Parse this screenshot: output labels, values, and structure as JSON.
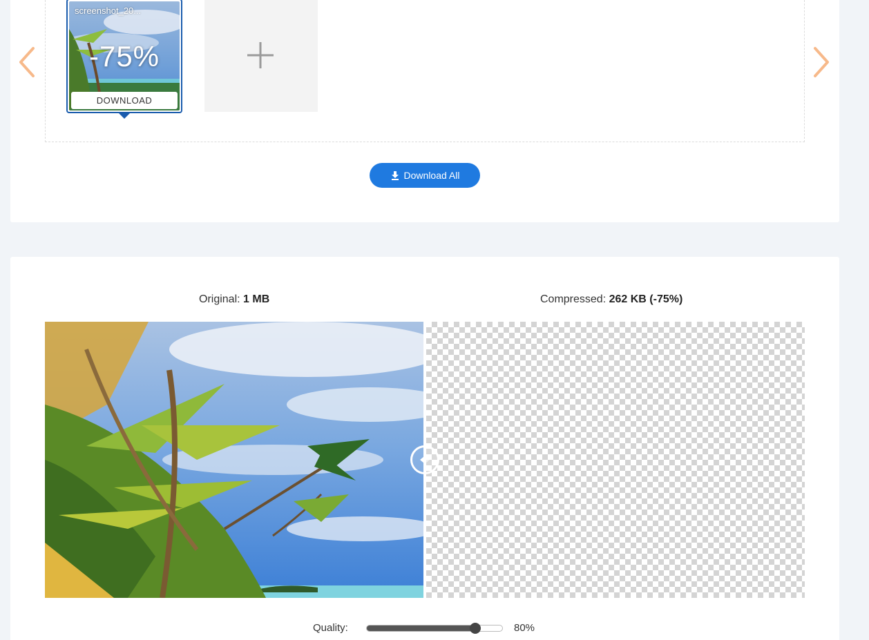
{
  "queue": {
    "items": [
      {
        "filename": "screenshot_20...",
        "reduction": "-75%",
        "download_label": "DOWNLOAD"
      }
    ],
    "download_all_label": "Download All"
  },
  "comparison": {
    "original_label": "Original:",
    "original_size": "1 MB",
    "compressed_label": "Compressed:",
    "compressed_size": "262 KB (-75%)"
  },
  "quality": {
    "label": "Quality:",
    "value": 0.8,
    "value_text": "80%"
  },
  "colors": {
    "accent": "#1f7ae0",
    "selected_border": "#1a5cad",
    "nav_arrow": "#f7b98a"
  },
  "icons": [
    "chevron-left-icon",
    "chevron-right-icon",
    "plus-icon",
    "download-icon",
    "compare-handle-icon"
  ]
}
